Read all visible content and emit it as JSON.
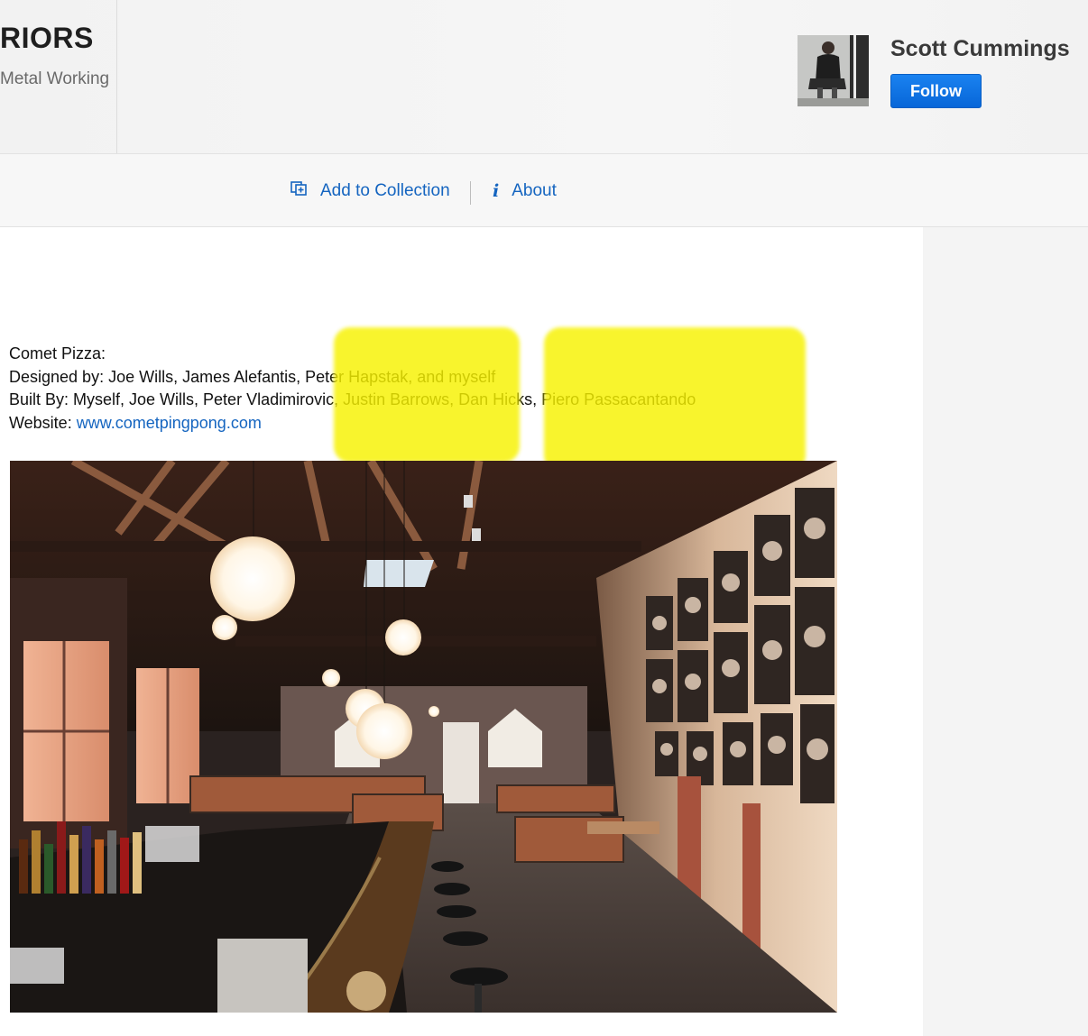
{
  "header": {
    "project_title": "RIORS",
    "project_field": "Metal Working",
    "owner": {
      "name": "Scott Cummings",
      "follow_label": "Follow"
    }
  },
  "actions": {
    "add_to_collection": "Add to Collection",
    "about": "About"
  },
  "description": {
    "lines": [
      "Comet Pizza:",
      "Designed by: Joe Wills, James Alefantis, Peter Hapstak, and myself",
      "Built By: Myself, Joe Wills, Peter Vladimirovic, Justin Barrows, Dan Hicks, Piero Passacantando"
    ],
    "website_label": "Website:",
    "website_url": "www.cometpingpong.com"
  },
  "colors": {
    "accent_blue": "#1565c0",
    "follow_blue": "#0766d8",
    "highlight_yellow": "#f7f200"
  },
  "icons": {
    "collection": "add-to-collection-icon",
    "about": "info-icon"
  }
}
